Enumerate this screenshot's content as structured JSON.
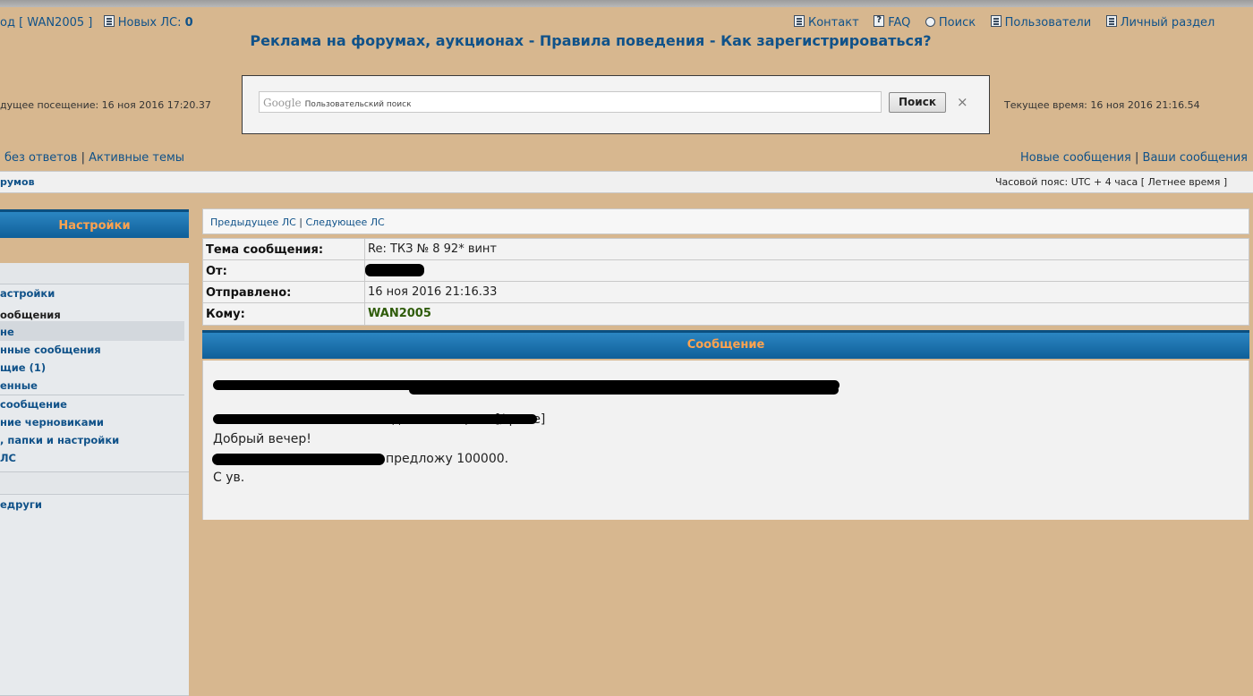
{
  "header": {
    "user_link_prefix": "од [",
    "user_link": "WAN2005",
    "user_link_suffix": "]",
    "new_pm_label": "Новых ЛС:",
    "new_pm_count": "0",
    "links": [
      "Контакт",
      "FAQ",
      "Поиск",
      "Пользователи",
      "Личный раздел"
    ],
    "headline": {
      "ads": "Реклама на форумах, аукционах",
      "rules": "Правила поведения",
      "register": "Как зарегистрироваться?",
      "separator": " - "
    }
  },
  "search": {
    "google_label": "Google",
    "placeholder": "Пользовательский поиск",
    "button": "Поиск",
    "close": "×"
  },
  "times": {
    "last_visit": "дущее посещение: 16 ноя 2016 17:20.37",
    "current": "Текущее время: 16 ноя 2016 21:16.54"
  },
  "nav": {
    "left": [
      "без ответов",
      "Активные темы"
    ],
    "right": [
      "Новые сообщения",
      "Ваши сообщения"
    ],
    "separator": "|"
  },
  "bar": {
    "left": "румов",
    "timezone": "Часовой пояс: UTC + 4 часа [ Летнее время ]"
  },
  "sidebar": {
    "title": "Настройки",
    "items": {
      "settings": "астройки",
      "messages": "ообщения",
      "item1": "не",
      "item2": "нные сообщения",
      "item3": "щие (1)",
      "item4": "енные",
      "item5": "сообщение",
      "item6": "ние черновиками",
      "item7": ", папки и настройки",
      "item8": "ЛС",
      "friends": "едруги"
    }
  },
  "pm": {
    "prev": "Предыдущее ЛС",
    "next": "Следующее ЛС",
    "separator": "|",
    "subject_label": "Тема сообщения:",
    "subject": "Re: ТКЗ № 8 92* винт",
    "from_label": "От:",
    "sent_label": "Отправлено:",
    "sent": "16 ноя 2016 21:16.33",
    "to_label": "Кому:",
    "to": "WAN2005",
    "message_title": "Сообщение",
    "body": {
      "quote_tail": "дена женщина.[/quote]",
      "greeting": "Добрый вечер!",
      "offer": "предложу 100000.",
      "signoff": "С ув."
    }
  }
}
